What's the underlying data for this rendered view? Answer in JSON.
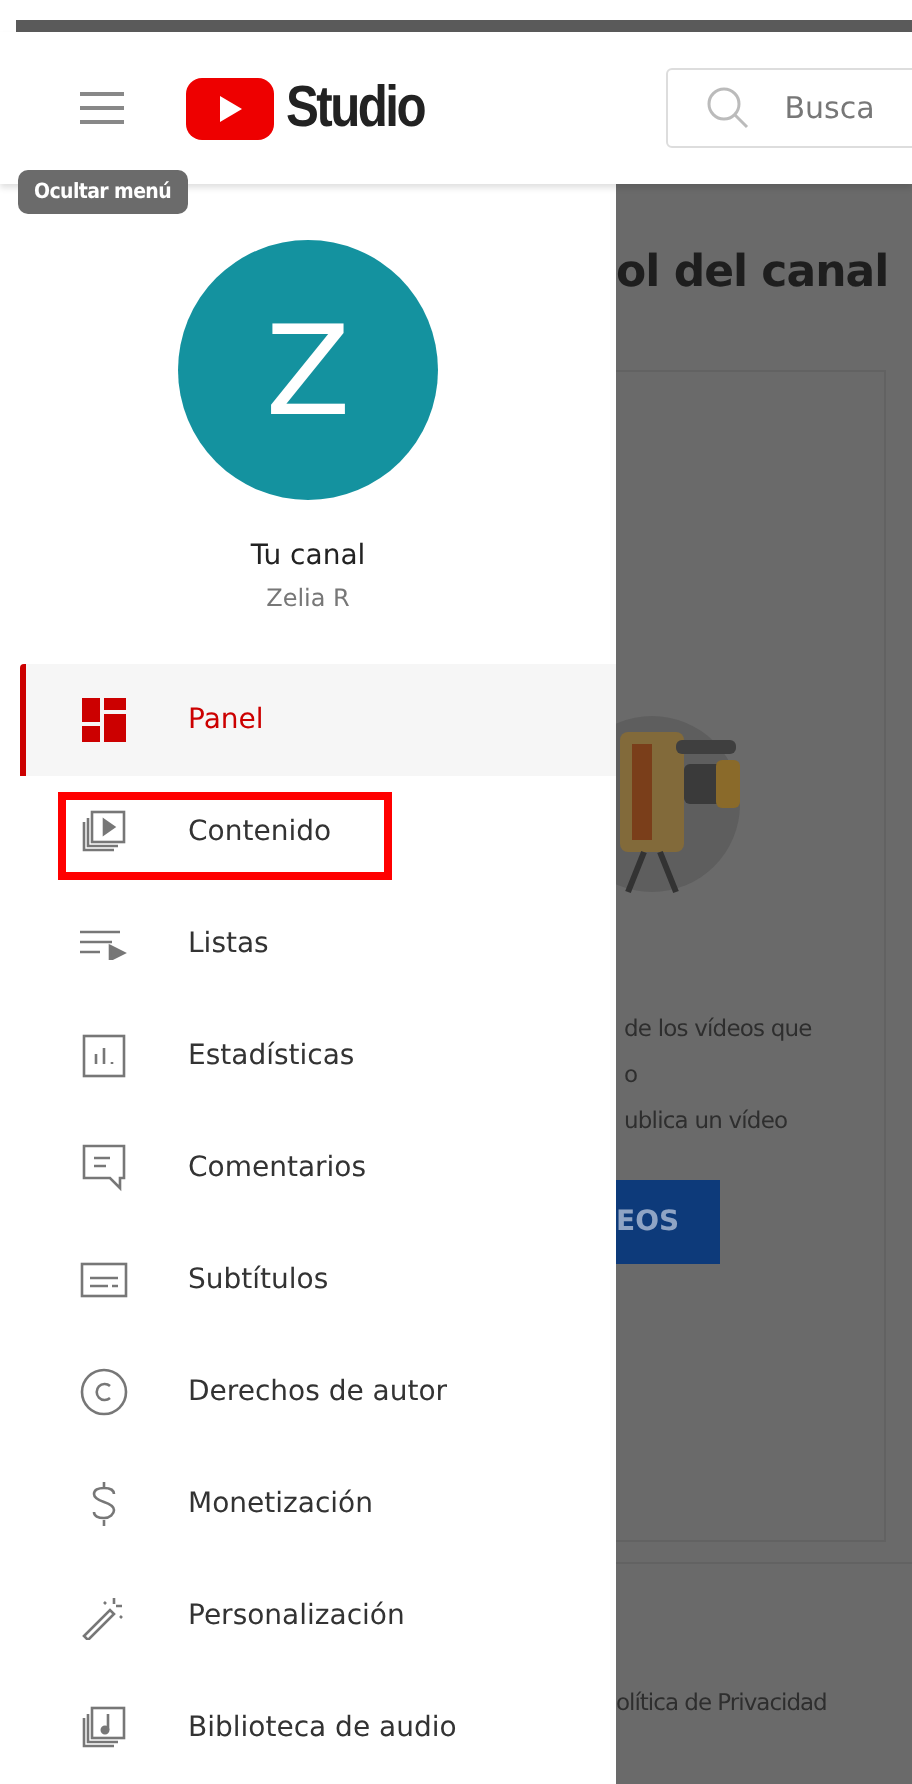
{
  "header": {
    "logo_text": "Studio",
    "search": {
      "placeholder": "Busca"
    }
  },
  "tooltip": "Ocultar menú",
  "channel": {
    "avatar_letter": "Z",
    "title": "Tu canal",
    "name": "Zelia R"
  },
  "menu": [
    {
      "label": "Panel",
      "selected": true,
      "outlined": false
    },
    {
      "label": "Contenido",
      "selected": false,
      "outlined": true
    },
    {
      "label": "Listas",
      "selected": false,
      "outlined": false
    },
    {
      "label": "Estadísticas",
      "selected": false,
      "outlined": false
    },
    {
      "label": "Comentarios",
      "selected": false,
      "outlined": false
    },
    {
      "label": "Subtítulos",
      "selected": false,
      "outlined": false
    },
    {
      "label": "Derechos de autor",
      "selected": false,
      "outlined": false
    },
    {
      "label": "Monetización",
      "selected": false,
      "outlined": false
    },
    {
      "label": "Personalización",
      "selected": false,
      "outlined": false
    },
    {
      "label": "Biblioteca de audio",
      "selected": false,
      "outlined": false
    }
  ],
  "background": {
    "heading": "ol del canal",
    "text_lines": [
      "de los vídeos que",
      "o",
      "ublica un vídeo"
    ],
    "button": "EOS",
    "footer_link": "olítica de Privacidad"
  }
}
